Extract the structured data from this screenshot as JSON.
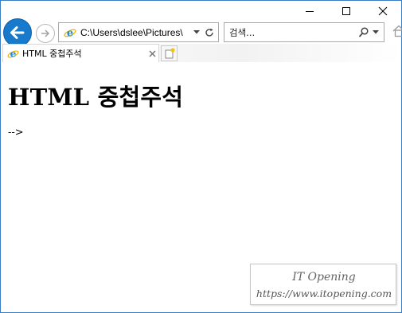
{
  "window": {
    "minimize_icon": "minimize-icon",
    "maximize_icon": "maximize-icon",
    "close_icon": "close-icon"
  },
  "nav": {
    "back_icon": "back-arrow-icon",
    "forward_icon": "forward-arrow-icon",
    "address": "C:\\Users\\dslee\\Pictures\\",
    "refresh_icon": "refresh-icon",
    "search_placeholder": "검색...",
    "search_icon": "search-icon",
    "home_icon": "home-icon"
  },
  "tabs": [
    {
      "title": "HTML 중첩주석",
      "active": true
    }
  ],
  "page": {
    "heading": "HTML 중첩주석",
    "body_text": "-->"
  },
  "watermark": {
    "title": "IT Opening",
    "url": "https://www.itopening.com"
  },
  "colors": {
    "back_button": "#1979ca",
    "window_border": "#3a7fc4",
    "ie_logo": "#1f8ad6",
    "ie_ring": "#f0b400"
  }
}
